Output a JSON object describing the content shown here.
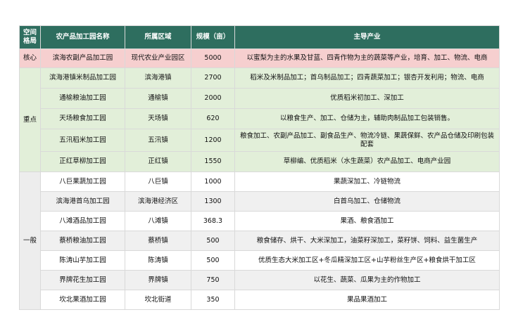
{
  "headers": {
    "layout": "空间\n格局",
    "name": "农产品加工园名称",
    "region": "所属区域",
    "scale": "规模（亩）",
    "industry": "主导产业"
  },
  "groups": {
    "core": "核心",
    "key": "重点",
    "general": "一般"
  },
  "rows": [
    {
      "name": "滨海农副产品加工园",
      "region": "现代农业产业园区",
      "scale": "5000",
      "industry": "以蜜梨为主的水果及甘蓝、四青作物为主的蔬菜等产业，培育、加工、物流、电商"
    },
    {
      "name": "滨海港镇米制品加工园",
      "region": "滨海港镇",
      "scale": "2700",
      "industry": "稻米及米制品加工；首乌制品加工；四青蔬菜加工；银杏开发利用；物流、电商"
    },
    {
      "name": "通榆粮油加工园",
      "region": "通榆镇",
      "scale": "2000",
      "industry": "优质稻米初加工、深加工"
    },
    {
      "name": "天场粮食加工园",
      "region": "天场镇",
      "scale": "620",
      "industry": "以粮食生产、加工、仓储为主，辅助肉制品加工包装销售。"
    },
    {
      "name": "五汛稻米加工园",
      "region": "五汛镇",
      "scale": "1200",
      "industry": "粮食加工、农副产品加工、副食品生产、物流冷链、果蔬保鲜、农产品仓储及印刷包装配套"
    },
    {
      "name": "正红草柳加工园",
      "region": "正红镇",
      "scale": "1550",
      "industry": "草柳编、优质稻米（水生蔬菜）农产品加工、电商产业园"
    },
    {
      "name": "八巨果蔬加工园",
      "region": "八巨镇",
      "scale": "1000",
      "industry": "果蔬深加工、冷链物流"
    },
    {
      "name": "滨海港首乌加工园",
      "region": "滨海港经济区",
      "scale": "1300",
      "industry": "白首乌加工、仓储物流"
    },
    {
      "name": "八滩酒品加工园",
      "region": "八滩镇",
      "scale": "368.3",
      "industry": "果酒、粮食酒加工"
    },
    {
      "name": "蔡桥粮油加工园",
      "region": "蔡桥镇",
      "scale": "500",
      "industry": "粮食储存、烘干、大米深加工，油菜籽深加工，菜籽饼、饲料、益生菌生产"
    },
    {
      "name": "陈涛山芋加工园",
      "region": "陈涛镇",
      "scale": "500",
      "industry": "优质生态大米加工区+冬瓜精深加工区+山芋粉丝生产区+粮食烘干加工区"
    },
    {
      "name": "界牌花生加工园",
      "region": "界牌镇",
      "scale": "750",
      "industry": "以花生、蔬菜、瓜果为主的作物加工"
    },
    {
      "name": "坎北果酒加工园",
      "region": "坎北街道",
      "scale": "350",
      "industry": "果品果酒加工"
    }
  ]
}
